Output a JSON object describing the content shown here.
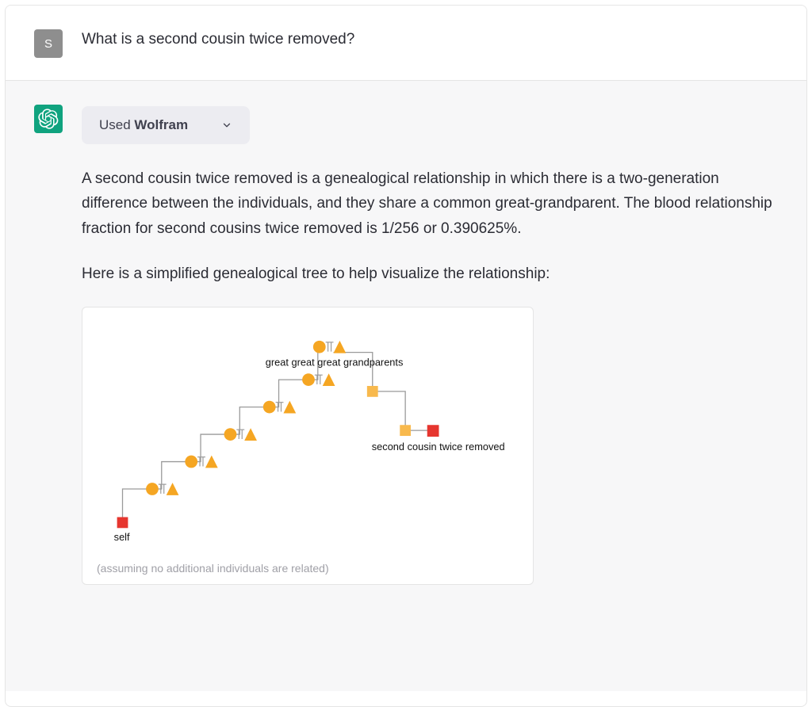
{
  "user": {
    "avatar_letter": "S",
    "message": "What is a second cousin twice removed?"
  },
  "assistant": {
    "plugin": {
      "used_prefix": "Used ",
      "name": "Wolfram"
    },
    "paragraph1": "A second cousin twice removed is a genealogical relationship in which there is a two-generation difference between the individuals, and they share a common great-grandparent. The blood relationship fraction for second cousins twice removed is 1/256 or 0.390625%.",
    "paragraph2": "Here is a simplified genealogical tree to help visualize the relationship:",
    "diagram": {
      "top_label": "great great great grandparents",
      "target_label": "second cousin twice removed",
      "self_label": "self",
      "caption": "(assuming no additional individuals are related)"
    }
  },
  "colors": {
    "accent_orange": "#f5a623",
    "accent_orange_light": "#f8b94d",
    "accent_red": "#e6362f",
    "assistant_green": "#10a37f"
  }
}
